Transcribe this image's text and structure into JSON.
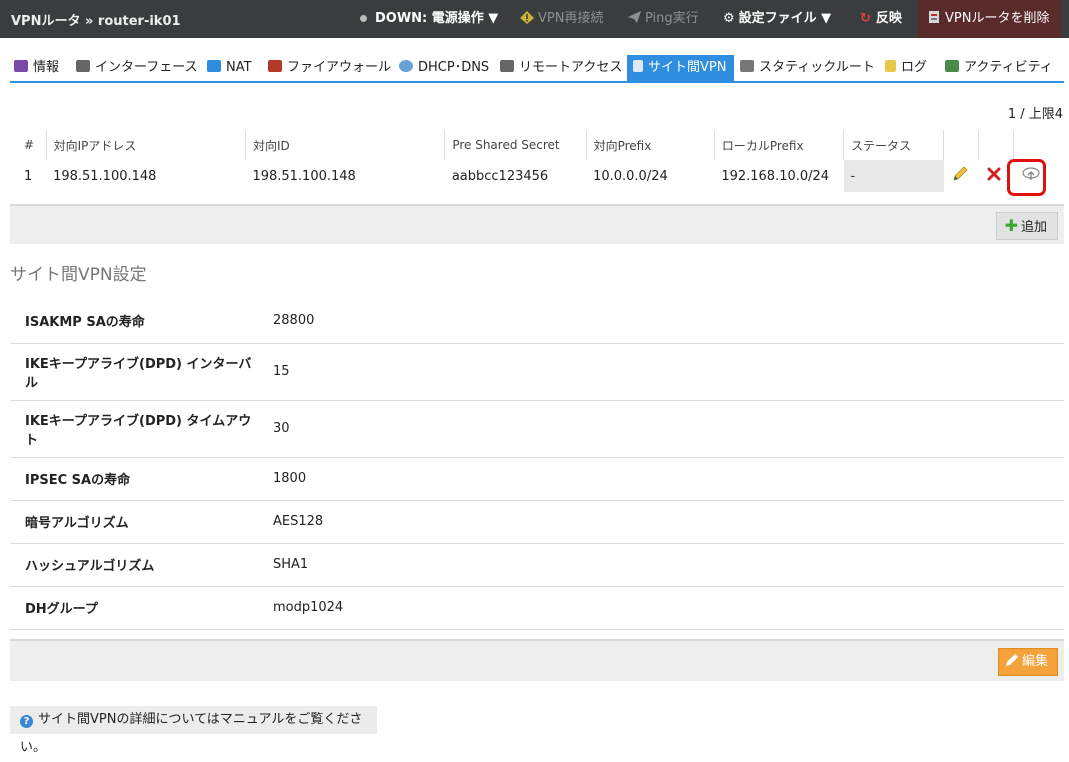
{
  "header": {
    "title": "VPNルータ » router-ik01",
    "status": "DOWN: 電源操作 ▼",
    "vpn_reconnect": "VPN再接続",
    "ping": "Ping実行",
    "config_file": "設定ファイル ▼",
    "apply": "反映",
    "delete_router": "VPNルータを削除"
  },
  "tabs": [
    "情報",
    "インターフェース",
    "NAT",
    "ファイアウォール",
    "DHCP･DNS",
    "リモートアクセス",
    "サイト間VPN",
    "スタティックルート",
    "ログ",
    "アクティビティ"
  ],
  "pager": "1 / 上限4",
  "table": {
    "headers": [
      "#",
      "対向IPアドレス",
      "対向ID",
      "Pre Shared Secret",
      "対向Prefix",
      "ローカルPrefix",
      "ステータス"
    ],
    "rows": [
      [
        "1",
        "198.51.100.148",
        "198.51.100.148",
        "aabbcc123456",
        "10.0.0.0/24",
        "192.168.10.0/24",
        "-"
      ]
    ]
  },
  "add_label": "追加",
  "section_title": "サイト間VPN設定",
  "settings": [
    {
      "key": "ISAKMP SAの寿命",
      "value": "28800"
    },
    {
      "key": "IKEキープアライブ(DPD) インターバル",
      "value": "15"
    },
    {
      "key": "IKEキープアライブ(DPD) タイムアウト",
      "value": "30"
    },
    {
      "key": "IPSEC SAの寿命",
      "value": "1800"
    },
    {
      "key": "暗号アルゴリズム",
      "value": "AES128"
    },
    {
      "key": "ハッシュアルゴリズム",
      "value": "SHA1"
    },
    {
      "key": "DHグループ",
      "value": "modp1024"
    }
  ],
  "edit_label": "編集",
  "help_text": "サイト間VPNの詳細についてはマニュアルをご覧ください。",
  "help_icon": "?",
  "colors": {
    "accent": "#2f8ee0",
    "danger_bg": "#5a2b2b",
    "edit": "#f4a23a",
    "highlight": "#e01010"
  }
}
